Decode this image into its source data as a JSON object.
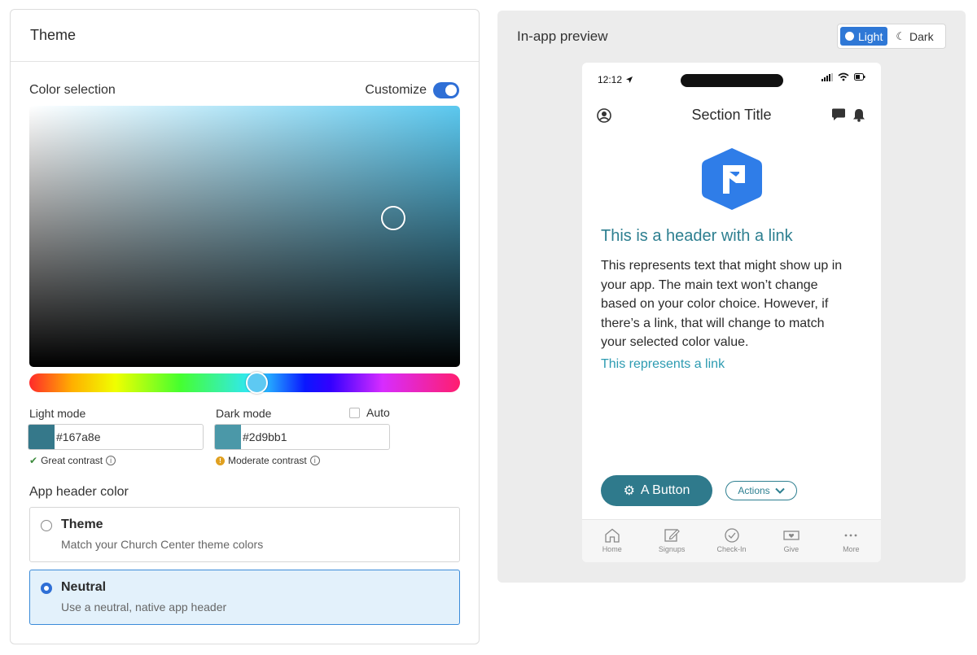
{
  "theme": {
    "title": "Theme",
    "color_section_title": "Color selection",
    "customize_label": "Customize",
    "customize_on": true,
    "picker_base_color": "#5bc8ef",
    "light_mode": {
      "label": "Light mode",
      "value": "#167a8e",
      "contrast": "Great contrast"
    },
    "dark_mode": {
      "label": "Dark mode",
      "value": "#2d9bb1",
      "contrast": "Moderate contrast"
    },
    "auto_label": "Auto",
    "auto_checked": false,
    "app_header_title": "App header color",
    "options": [
      {
        "title": "Theme",
        "subtitle": "Match your Church Center theme colors",
        "selected": false
      },
      {
        "title": "Neutral",
        "subtitle": "Use a neutral, native app header",
        "selected": true
      }
    ]
  },
  "preview": {
    "title": "In-app preview",
    "modes": [
      {
        "label": "Light",
        "icon": "sun-icon",
        "active": true
      },
      {
        "label": "Dark",
        "icon": "moon-icon",
        "active": false
      }
    ],
    "phone": {
      "time": "12:12",
      "section_title": "Section Title",
      "header_link": "This is a header with a link",
      "body_text": "This represents text that might show up in your app. The main text won’t change based on your color choice. However, if there’s a link, that will change to match your selected color value.",
      "link_text": "This represents a link",
      "button_label": "A Button",
      "actions_label": "Actions",
      "tabs": [
        {
          "label": "Home",
          "icon": "home-icon"
        },
        {
          "label": "Signups",
          "icon": "edit-icon"
        },
        {
          "label": "Check-In",
          "icon": "check-circle-icon"
        },
        {
          "label": "Give",
          "icon": "give-icon"
        },
        {
          "label": "More",
          "icon": "more-icon"
        }
      ]
    }
  }
}
